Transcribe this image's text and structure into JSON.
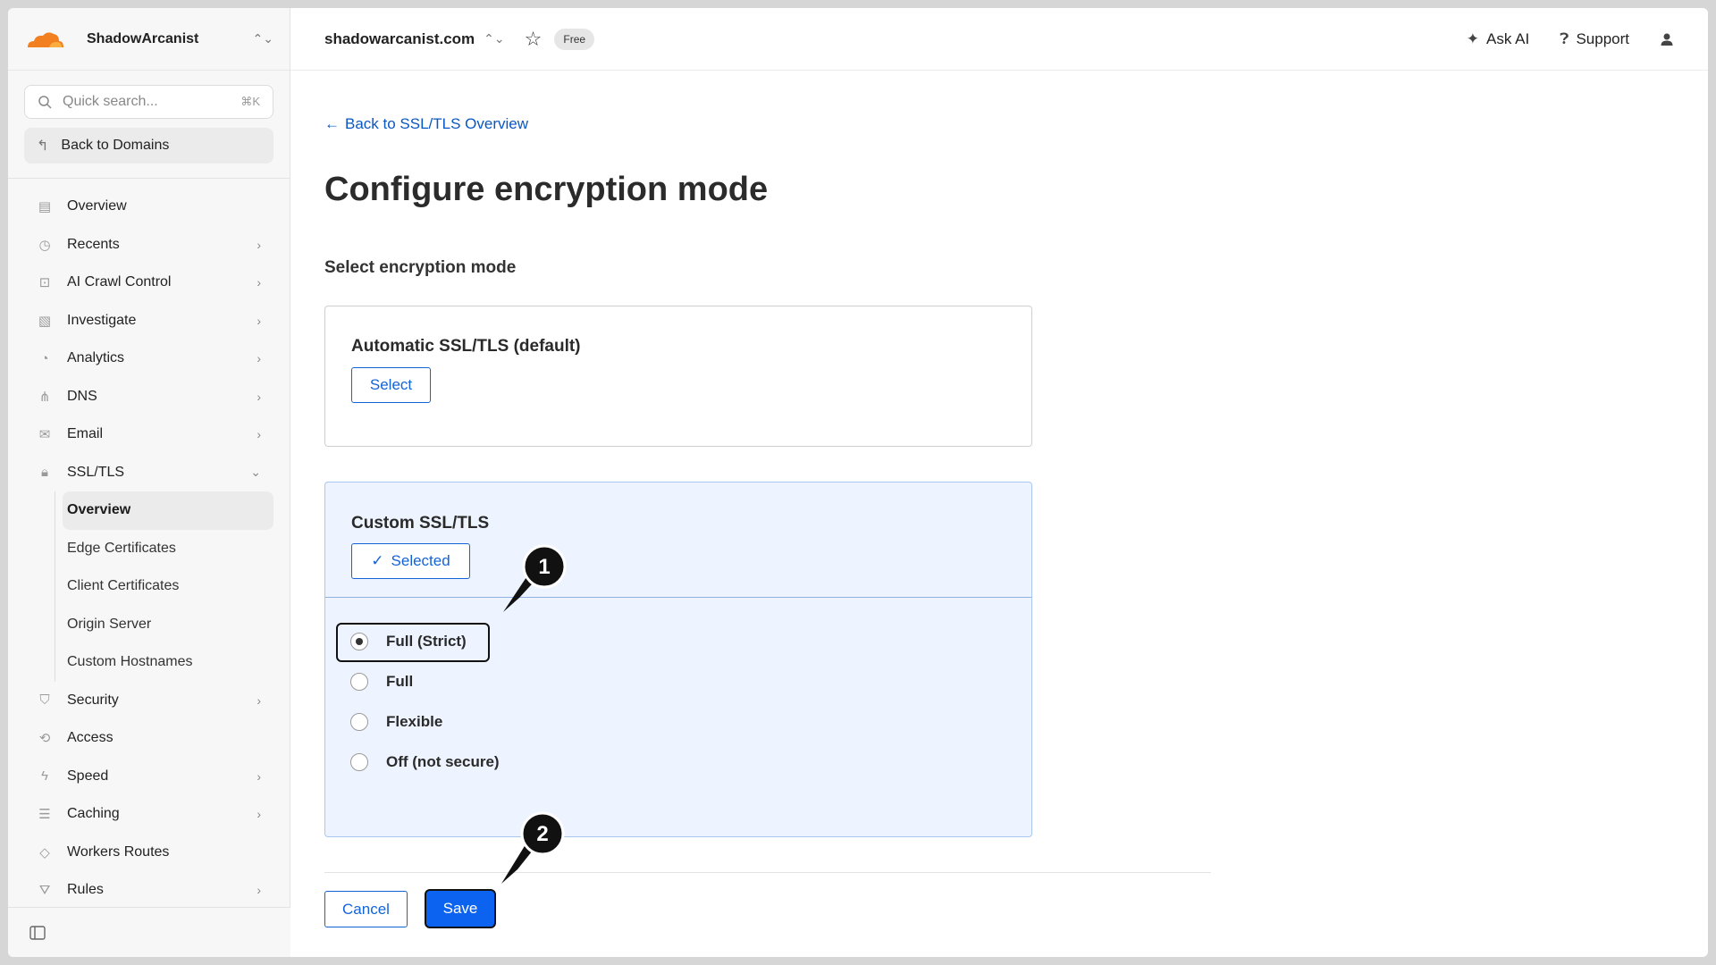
{
  "account": {
    "name": "ShadowArcanist"
  },
  "search": {
    "placeholder": "Quick search...",
    "shortcut": "⌘K"
  },
  "sidebar": {
    "back_label": "Back to Domains",
    "items": [
      {
        "label": "Overview",
        "icon": "document-icon",
        "chevron": false
      },
      {
        "label": "Recents",
        "icon": "clock-icon",
        "chevron": true
      },
      {
        "label": "AI Crawl Control",
        "icon": "robot-icon",
        "chevron": true
      },
      {
        "label": "Investigate",
        "icon": "search-doc-icon",
        "chevron": true
      },
      {
        "label": "Analytics",
        "icon": "pie-chart-icon",
        "chevron": true
      },
      {
        "label": "DNS",
        "icon": "sitemap-icon",
        "chevron": true
      },
      {
        "label": "Email",
        "icon": "envelope-icon",
        "chevron": true
      },
      {
        "label": "SSL/TLS",
        "icon": "lock-icon",
        "chevron": true
      }
    ],
    "ssl_sub": [
      "Overview",
      "Edge Certificates",
      "Client Certificates",
      "Origin Server",
      "Custom Hostnames"
    ],
    "items_after": [
      {
        "label": "Security",
        "icon": "shield-icon",
        "chevron": true
      },
      {
        "label": "Access",
        "icon": "access-icon",
        "chevron": false
      },
      {
        "label": "Speed",
        "icon": "bolt-icon",
        "chevron": true
      },
      {
        "label": "Caching",
        "icon": "stack-icon",
        "chevron": true
      },
      {
        "label": "Workers Routes",
        "icon": "diamond-icon",
        "chevron": false
      },
      {
        "label": "Rules",
        "icon": "rules-icon",
        "chevron": true
      }
    ]
  },
  "topbar": {
    "domain": "shadowarcanist.com",
    "plan_badge": "Free",
    "ask_ai": "Ask AI",
    "support": "Support"
  },
  "main": {
    "back_link": "Back to SSL/TLS Overview",
    "title": "Configure encryption mode",
    "section_title": "Select encryption mode",
    "auto_card": {
      "title": "Automatic SSL/TLS (default)",
      "button": "Select"
    },
    "custom_card": {
      "title": "Custom SSL/TLS",
      "button": "Selected",
      "options": [
        "Full (Strict)",
        "Full",
        "Flexible",
        "Off (not secure)"
      ],
      "selected_index": 0
    },
    "cancel": "Cancel",
    "save": "Save"
  },
  "callouts": [
    "1",
    "2"
  ],
  "colors": {
    "accent": "#0b63f0",
    "link": "#0a57c2",
    "selected_bg": "#eef4ff",
    "logo": "#f38020"
  }
}
